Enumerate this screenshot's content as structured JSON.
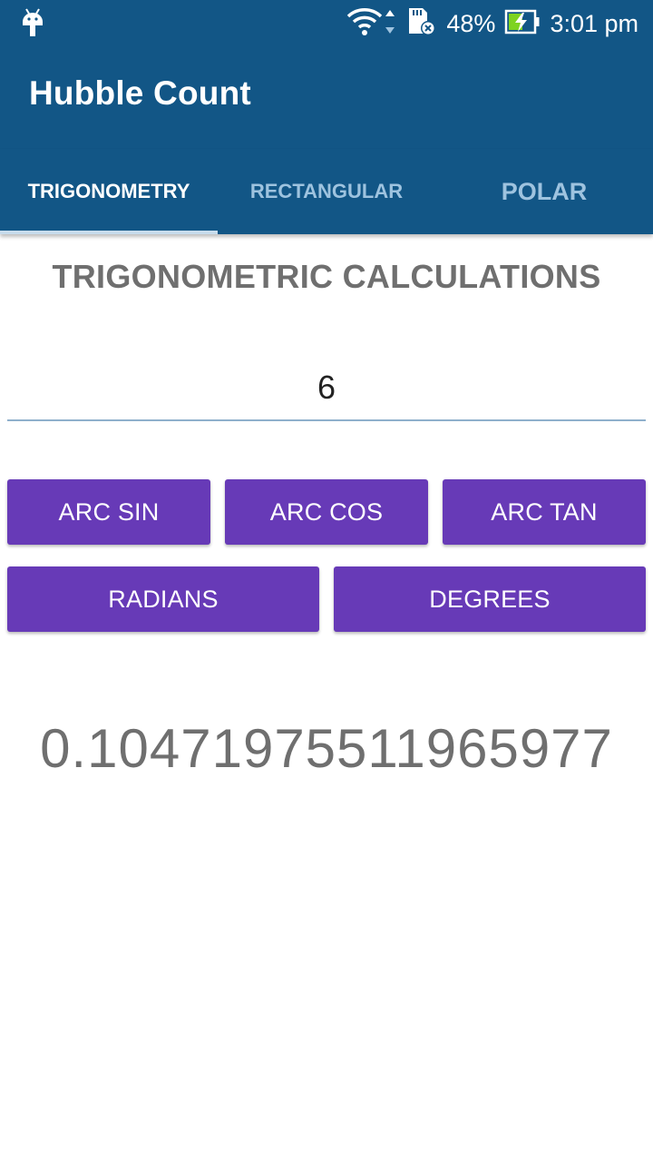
{
  "status_bar": {
    "battery_percent": "48%",
    "time": "3:01 pm"
  },
  "app": {
    "title": "Hubble Count"
  },
  "tabs": [
    {
      "label": "TRIGONOMETRY",
      "selected": true
    },
    {
      "label": "RECTANGULAR",
      "selected": false
    },
    {
      "label": "POLAR",
      "selected": false
    }
  ],
  "main": {
    "section_title": "TRIGONOMETRIC CALCULATIONS",
    "input_value": "6",
    "buttons": {
      "arc_sin": "ARC SIN",
      "arc_cos": "ARC COS",
      "arc_tan": "ARC TAN",
      "radians": "RADIANS",
      "degrees": "DEGREES"
    },
    "result": "0.10471975511965977"
  },
  "colors": {
    "primary": "#125686",
    "accent": "#673ab7",
    "text_gray": "#6f6f6f"
  }
}
